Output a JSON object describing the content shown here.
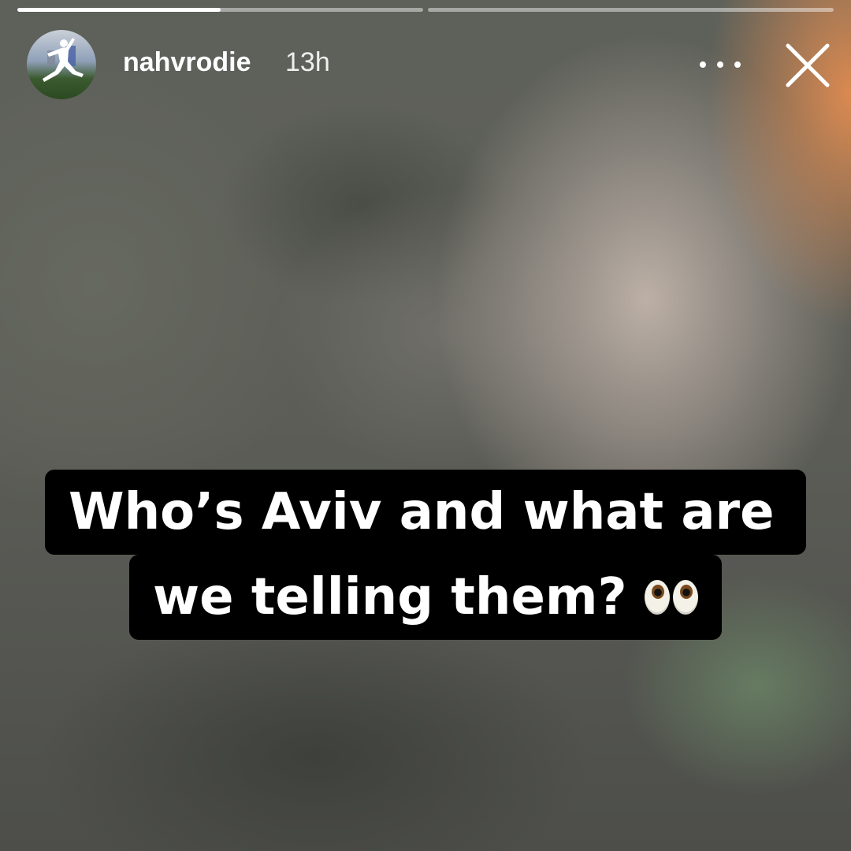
{
  "story": {
    "progress_segments": [
      {
        "fill_fraction": 0.5
      },
      {
        "fill_fraction": 0
      }
    ],
    "header": {
      "username": "nahvrodie",
      "timestamp": "13h",
      "avatar_icon": "jumpman-logo-icon",
      "more_icon": "more-horizontal-icon",
      "close_icon": "close-icon"
    },
    "caption": {
      "line1": "Who’s Aviv and what are",
      "line2": "we telling them?",
      "emoji": "eyes-emoji"
    }
  }
}
